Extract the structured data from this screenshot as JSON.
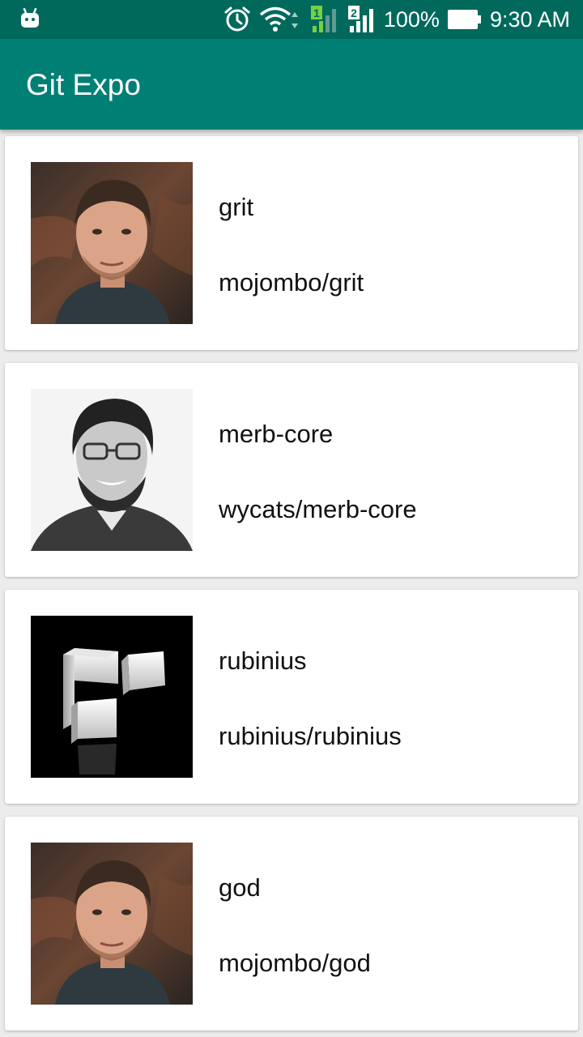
{
  "status_bar": {
    "battery_percent": "100%",
    "time": "9:30 AM",
    "sim1_label": "1",
    "sim2_label": "2",
    "icons": [
      "android-icon",
      "alarm-icon",
      "wifi-icon",
      "sim1-signal-icon",
      "sim2-signal-icon",
      "battery-icon"
    ]
  },
  "app_bar": {
    "title": "Git Expo"
  },
  "repos": [
    {
      "name": "grit",
      "full_name": "mojombo/grit",
      "avatar": "portrait-man-dark-background"
    },
    {
      "name": "merb-core",
      "full_name": "wycats/merb-core",
      "avatar": "portrait-man-glasses-bw"
    },
    {
      "name": "rubinius",
      "full_name": "rubinius/rubinius",
      "avatar": "rubinius-logo-cubes"
    },
    {
      "name": "god",
      "full_name": "mojombo/god",
      "avatar": "portrait-man-dark-background"
    }
  ],
  "colors": {
    "status_bar": "#00695c",
    "app_bar": "#008075",
    "background": "#ececec",
    "card": "#ffffff"
  }
}
